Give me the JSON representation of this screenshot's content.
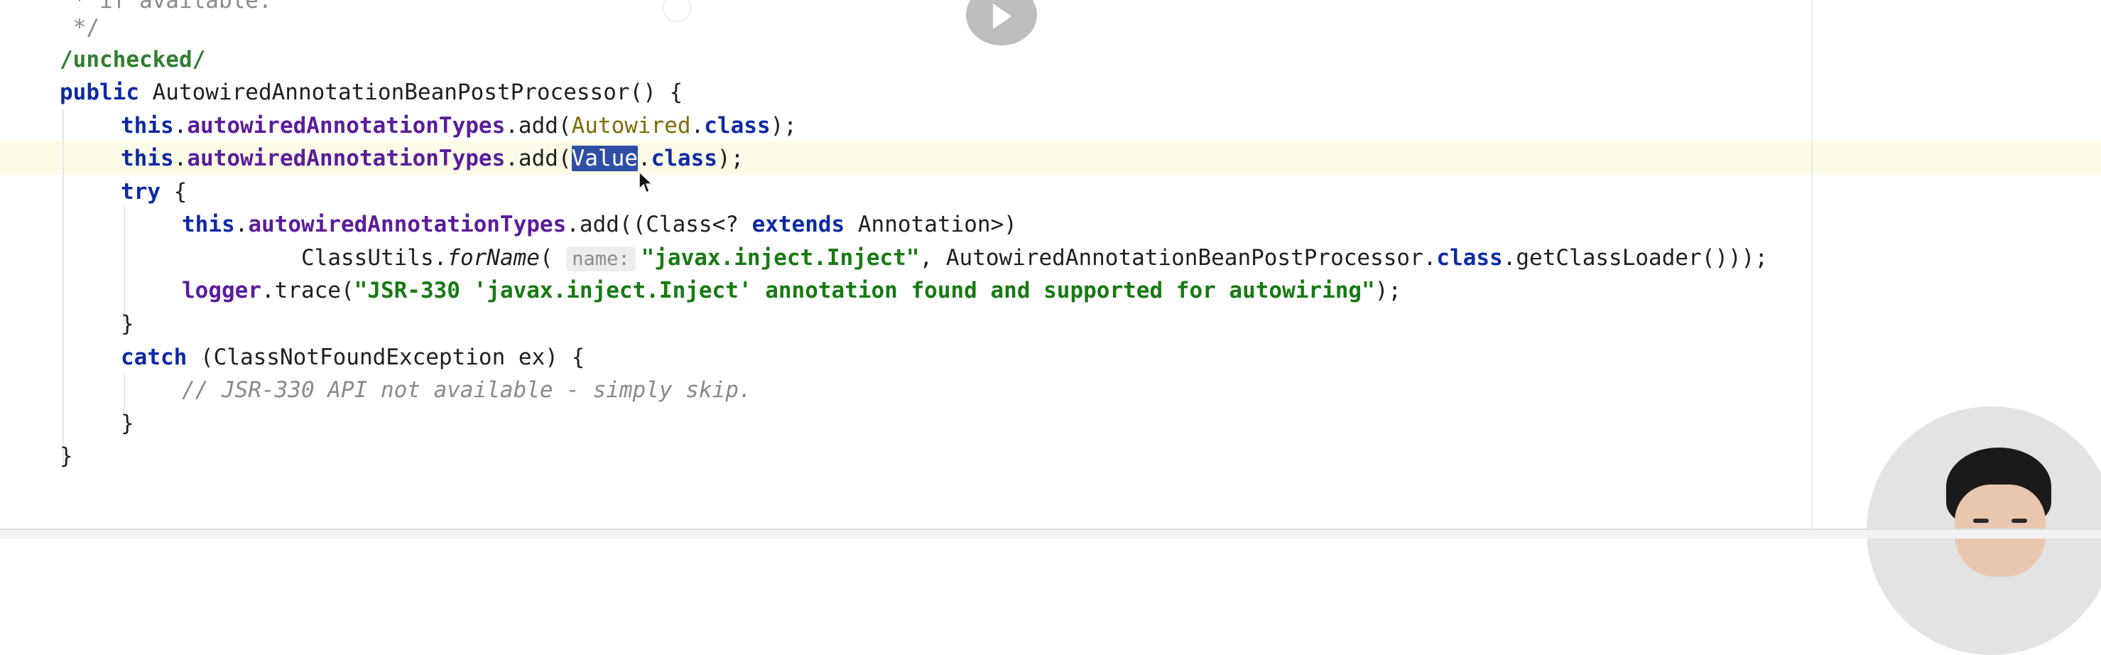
{
  "code": {
    "line_top_partial": " * if available.",
    "line_comment_end": " */",
    "annotation": "/unchecked/",
    "constructor": {
      "kw_public": "public",
      "signature": " AutowiredAnnotationBeanPostProcessor() {"
    },
    "add_autowired": {
      "kw_this": "this",
      "field": "autowiredAnnotationTypes",
      "call": ".add(",
      "type": "Autowired",
      "kw_class": "class",
      "end": ");"
    },
    "add_value": {
      "kw_this": "this",
      "field": "autowiredAnnotationTypes",
      "call": ".add(",
      "selected": "Value",
      "kw_class": "class",
      "end": ");"
    },
    "try_line": {
      "kw_try": "try",
      "rest": " {"
    },
    "add_inject": {
      "kw_this": "this",
      "field": "autowiredAnnotationTypes",
      "call": ".add((Class<? ",
      "kw_extends": "extends",
      "rest": " Annotation>)"
    },
    "forname_line": {
      "cls": "ClassUtils.",
      "method": "forName",
      "paren": "( ",
      "hint": "name:",
      "string": "\"javax.inject.Inject\"",
      "mid": ", AutowiredAnnotationBeanPostProcessor.",
      "kw_class": "class",
      "end": ".getClassLoader()));"
    },
    "logger_line": {
      "field": "logger",
      "call": ".trace(",
      "string": "\"JSR-330 'javax.inject.Inject' annotation found and supported for autowiring\"",
      "end": ");"
    },
    "close_try": "}",
    "catch_line": {
      "kw_catch": "catch",
      "rest": " (ClassNotFoundException ex) {"
    },
    "comment_line": "// JSR-330 API not available - simply skip.",
    "close_catch": "}",
    "close_method": "}"
  },
  "icons": {
    "play": "play-icon",
    "cursor": "mouse-cursor-icon",
    "avatar": "presenter-webcam-avatar"
  },
  "colors": {
    "keyword": "#0f2aa3",
    "field": "#5b1d9a",
    "string": "#187a14",
    "annotation_type": "#7d6d00",
    "selection": "#2f4fa6",
    "current_line": "#fbfbe8"
  }
}
